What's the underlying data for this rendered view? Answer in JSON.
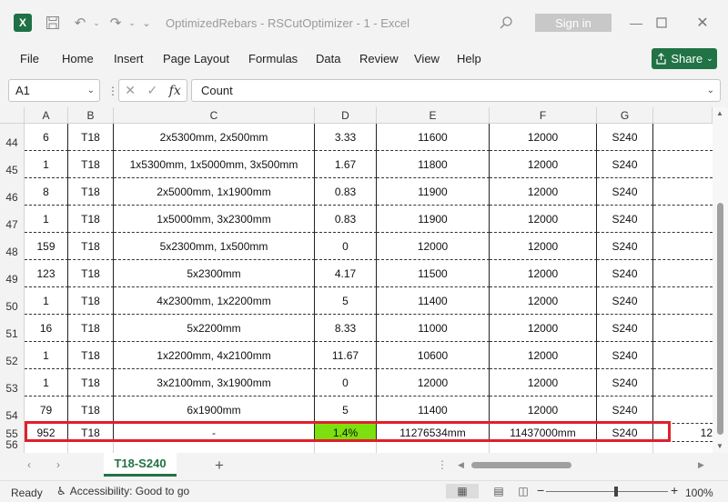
{
  "titlebar": {
    "app_icon": "X",
    "title": "OptimizedRebars - RSCutOptimizer - 1  -  Excel",
    "signin": "Sign in"
  },
  "menu": [
    "File",
    "Home",
    "Insert",
    "Page Layout",
    "Formulas",
    "Data",
    "Review",
    "View",
    "Help"
  ],
  "share": "Share",
  "formula_bar": {
    "name_box": "A1",
    "formula": "Count"
  },
  "columns": [
    "A",
    "B",
    "C",
    "D",
    "E",
    "F",
    "G"
  ],
  "rows": [
    {
      "num": "44",
      "cells": [
        "6",
        "T18",
        "2x5300mm, 2x500mm",
        "3.33",
        "11600",
        "12000",
        "S240"
      ]
    },
    {
      "num": "45",
      "cells": [
        "1",
        "T18",
        "1x5300mm, 1x5000mm, 3x500mm",
        "1.67",
        "11800",
        "12000",
        "S240"
      ]
    },
    {
      "num": "46",
      "cells": [
        "8",
        "T18",
        "2x5000mm, 1x1900mm",
        "0.83",
        "11900",
        "12000",
        "S240"
      ]
    },
    {
      "num": "47",
      "cells": [
        "1",
        "T18",
        "1x5000mm, 3x2300mm",
        "0.83",
        "11900",
        "12000",
        "S240"
      ]
    },
    {
      "num": "48",
      "cells": [
        "159",
        "T18",
        "5x2300mm, 1x500mm",
        "0",
        "12000",
        "12000",
        "S240"
      ]
    },
    {
      "num": "49",
      "cells": [
        "123",
        "T18",
        "5x2300mm",
        "4.17",
        "11500",
        "12000",
        "S240"
      ]
    },
    {
      "num": "50",
      "cells": [
        "1",
        "T18",
        "4x2300mm, 1x2200mm",
        "5",
        "11400",
        "12000",
        "S240"
      ]
    },
    {
      "num": "51",
      "cells": [
        "16",
        "T18",
        "5x2200mm",
        "8.33",
        "11000",
        "12000",
        "S240"
      ]
    },
    {
      "num": "52",
      "cells": [
        "1",
        "T18",
        "1x2200mm, 4x2100mm",
        "11.67",
        "10600",
        "12000",
        "S240"
      ]
    },
    {
      "num": "53",
      "cells": [
        "1",
        "T18",
        "3x2100mm, 3x1900mm",
        "0",
        "12000",
        "12000",
        "S240"
      ]
    },
    {
      "num": "54",
      "cells": [
        "79",
        "T18",
        "6x1900mm",
        "5",
        "11400",
        "12000",
        "S240"
      ]
    },
    {
      "num": "55",
      "cells": [
        "952",
        "T18",
        "-",
        "1.4%",
        "11276534mm",
        "11437000mm",
        "S240"
      ],
      "extra": "12"
    },
    {
      "num": "56",
      "cells": [
        "",
        "",
        "",
        "",
        "",
        "",
        ""
      ]
    }
  ],
  "sheet_tab": "T18-S240",
  "status": {
    "ready": "Ready",
    "accessibility": "Accessibility: Good to go",
    "zoom": "100%"
  },
  "colors": {
    "excel_green": "#217346",
    "highlight_red": "#e0202a",
    "pct_fill": "#7be00e"
  }
}
